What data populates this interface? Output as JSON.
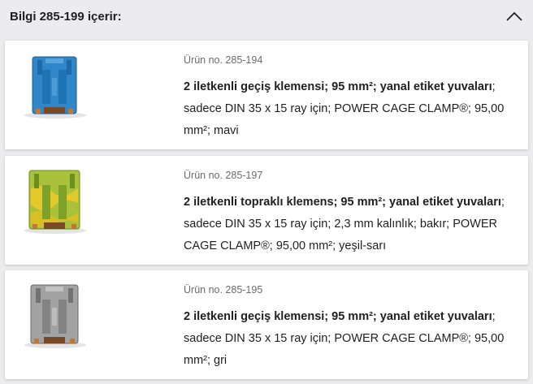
{
  "header": {
    "title": "Bilgi 285-199 içerir:"
  },
  "products": [
    {
      "number": "Ürün no. 285-194",
      "title": "2 iletkenli geçiş klemensi; 95 mm²; yanal etiket yuvaları",
      "details": "; sadece DIN 35 x 15 ray için; POWER CAGE CLAMP®; 95,00 mm²; mavi",
      "color": "#2f86c8",
      "image": "blue-terminal-block"
    },
    {
      "number": "Ürün no. 285-197",
      "title": "2 iletkenli topraklı klemens; 95 mm²; yanal etiket yuvaları",
      "details": "; sadece DIN 35 x 15 ray için; 2,3 mm kalınlık; bakır; POWER CAGE CLAMP®; 95,00 mm²; yeşil-sarı",
      "color": "#9ab830",
      "image": "green-yellow-terminal-block"
    },
    {
      "number": "Ürün no. 285-195",
      "title": "2 iletkenli geçiş klemensi; 95 mm²; yanal etiket yuvaları",
      "details": "; sadece DIN 35 x 15 ray için; POWER CAGE CLAMP®; 95,00 mm²; gri",
      "color": "#9c9c9c",
      "image": "gray-terminal-block"
    }
  ]
}
